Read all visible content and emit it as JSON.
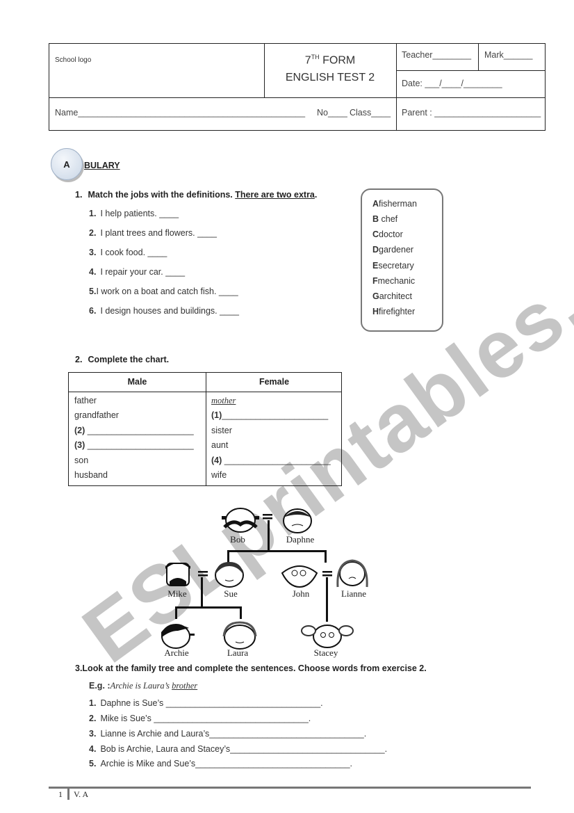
{
  "header": {
    "school_logo": "School logo",
    "form_number": "7",
    "form_suffix": "TH",
    "form_word": "FORM",
    "test_title": "ENGLISH TEST 2",
    "teacher": "Teacher________",
    "mark": "Mark______",
    "date": "Date: ___/____/________",
    "name": "Name_______________________________________________",
    "number": "No____",
    "class": "Class____",
    "parent": "Parent : ______________________"
  },
  "section": {
    "badge": "A",
    "title": "BULARY"
  },
  "exercise1": {
    "number": "1.",
    "instruction": "Match the jobs with the definitions. ",
    "instruction_underlined": "There are two extra",
    "instruction_end": ".",
    "items": [
      {
        "num": "1.",
        "text": "I help patients.  ____"
      },
      {
        "num": "2.",
        "text": "I plant trees and flowers.  ____"
      },
      {
        "num": "3.",
        "text": "I cook food.  ____"
      },
      {
        "num": "4.",
        "text": "I repair your car.  ____"
      },
      {
        "num": "5.",
        "text": "I work on a boat and catch fish.  ____"
      },
      {
        "num": "6.",
        "text": "I design houses and buildings.  ____"
      }
    ],
    "jobs": [
      {
        "letter": "A",
        "job": "fisherman"
      },
      {
        "letter": "B",
        "job": " chef"
      },
      {
        "letter": "C",
        "job": "doctor"
      },
      {
        "letter": "D",
        "job": "gardener"
      },
      {
        "letter": "E",
        "job": "secretary"
      },
      {
        "letter": "F",
        "job": "mechanic"
      },
      {
        "letter": "G",
        "job": "architect"
      },
      {
        "letter": "H",
        "job": "firefighter"
      }
    ]
  },
  "exercise2": {
    "number": "2.",
    "instruction": "Complete the chart.",
    "headers": [
      "Male",
      "Female"
    ],
    "male": [
      {
        "label": "",
        "text": "father"
      },
      {
        "label": "",
        "text": "grandfather"
      },
      {
        "label": "(2)",
        "text": " ______________________"
      },
      {
        "label": "(3)",
        "text": " ______________________"
      },
      {
        "label": "",
        "text": "son"
      },
      {
        "label": "",
        "text": "husband"
      }
    ],
    "female": [
      {
        "label": "",
        "text": "mother"
      },
      {
        "label": "(1)",
        "text": "______________________"
      },
      {
        "label": "",
        "text": "sister"
      },
      {
        "label": "",
        "text": "aunt"
      },
      {
        "label": "(4)",
        "text": " ______________________"
      },
      {
        "label": "",
        "text": "wife"
      }
    ]
  },
  "family_tree": {
    "members": [
      "Bob",
      "Daphne",
      "Mike",
      "Sue",
      "John",
      "Lianne",
      "Archie",
      "Laura",
      "Stacey"
    ],
    "marriage_symbol": "="
  },
  "exercise3": {
    "instruction": "3.Look at the family tree and complete the sentences. Choose words from exercise 2.",
    "example_label": "E.g. :",
    "example_text": "Archie is Laura’s ",
    "example_answer": "brother",
    "items": [
      {
        "num": "1.",
        "text": "Daphne is Sue’s ________________________________."
      },
      {
        "num": "2.",
        "text": "Mike is Sue’s ________________________________."
      },
      {
        "num": "3.",
        "text": "Lianne is Archie and Laura’s________________________________."
      },
      {
        "num": "4.",
        "text": "Bob is Archie, Laura and Stacey’s________________________________."
      },
      {
        "num": "5.",
        "text": "Archie is Mike and Sue’s________________________________."
      }
    ]
  },
  "watermark": "ESLprintables.com",
  "footer": {
    "page_number": "1",
    "author": "V. A"
  }
}
